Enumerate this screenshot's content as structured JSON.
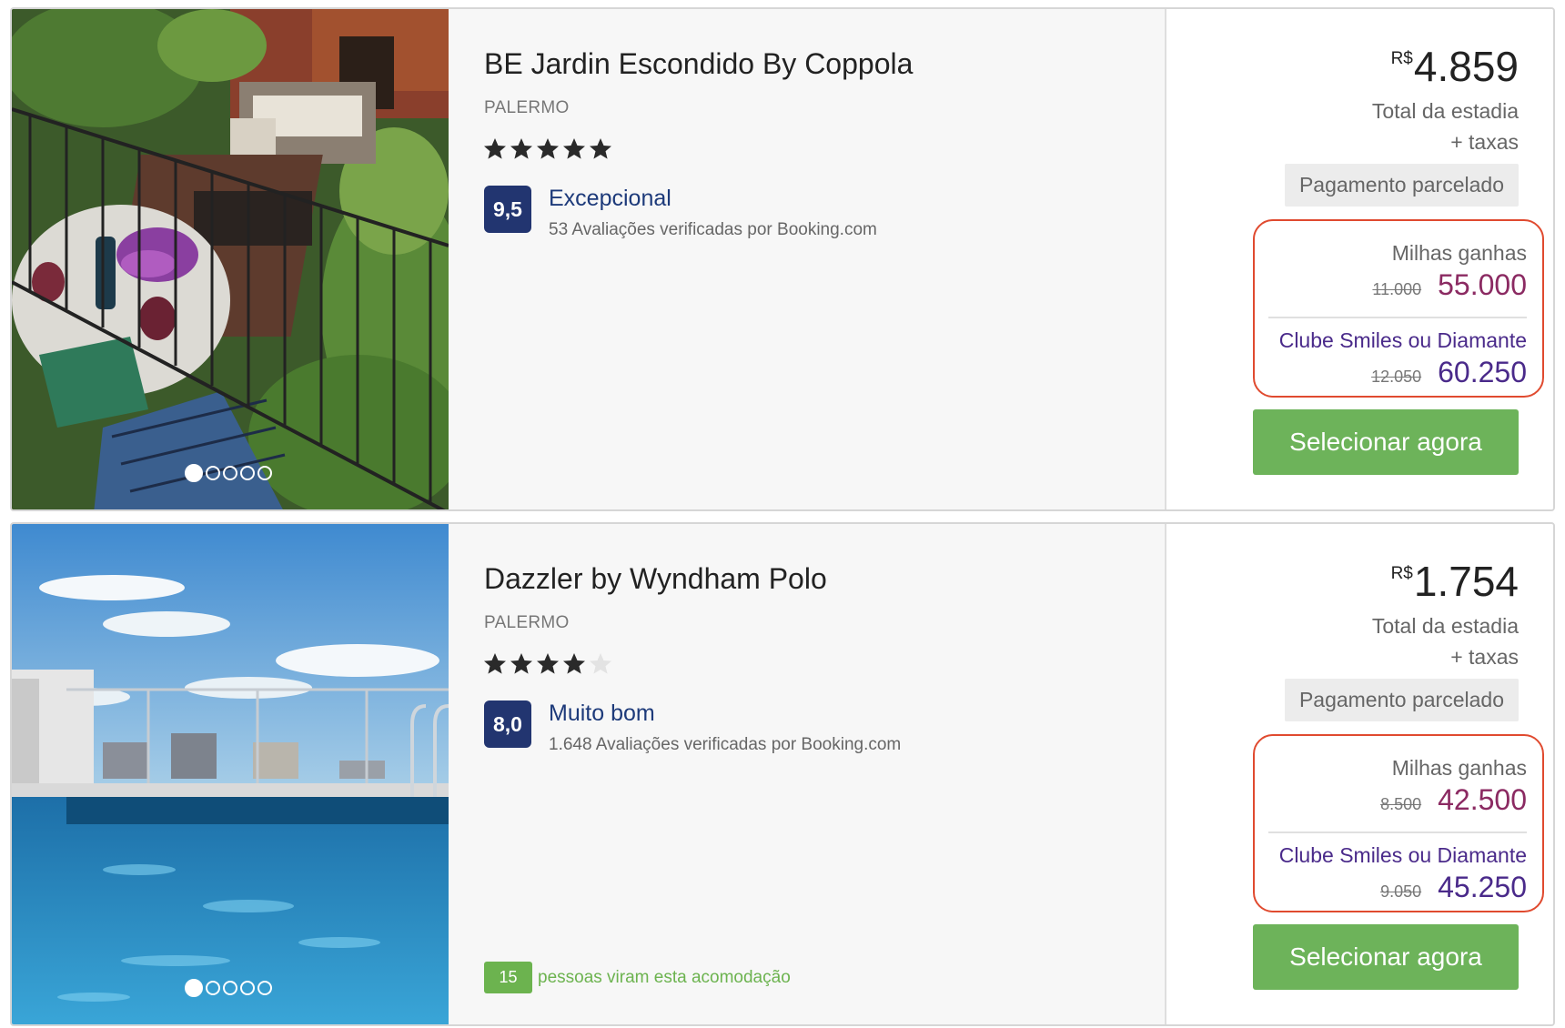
{
  "hotels": [
    {
      "name": "BE Jardin Escondido By Coppola",
      "district": "PALERMO",
      "stars": 5,
      "score": "9,5",
      "score_label": "Excepcional",
      "reviews": "53 Avaliações verificadas por Booking.com",
      "currency": "R$",
      "price": "4.859",
      "total_label": "Total da estadia",
      "taxes_label": "+ taxas",
      "installment_label": "Pagamento parcelado",
      "miles_label": "Milhas ganhas",
      "miles_old": "11.000",
      "miles_new": "55.000",
      "club_label": "Clube Smiles ou Diamante",
      "club_old": "12.050",
      "club_new": "60.250",
      "select_label": "Selecionar agora",
      "photo": "garden-terrace-photo",
      "slides": 5
    },
    {
      "name": "Dazzler by Wyndham Polo",
      "district": "PALERMO",
      "stars": 4,
      "score": "8,0",
      "score_label": "Muito bom",
      "reviews": "1.648 Avaliações verificadas por Booking.com",
      "currency": "R$",
      "price": "1.754",
      "total_label": "Total da estadia",
      "taxes_label": "+ taxas",
      "installment_label": "Pagamento parcelado",
      "miles_label": "Milhas ganhas",
      "miles_old": "8.500",
      "miles_new": "42.500",
      "club_label": "Clube Smiles ou Diamante",
      "club_old": "9.050",
      "club_new": "45.250",
      "select_label": "Selecionar agora",
      "viewers_count": "15",
      "viewers_text": "pessoas viram esta acomodação",
      "photo": "rooftop-pool-photo",
      "slides": 5
    }
  ],
  "colors": {
    "score_badge": "#223570",
    "select_button": "#6db35a",
    "miles_highlight_border": "#e04a2f",
    "miles_value": "#8b2a62",
    "club_value": "#4a2a8a"
  }
}
